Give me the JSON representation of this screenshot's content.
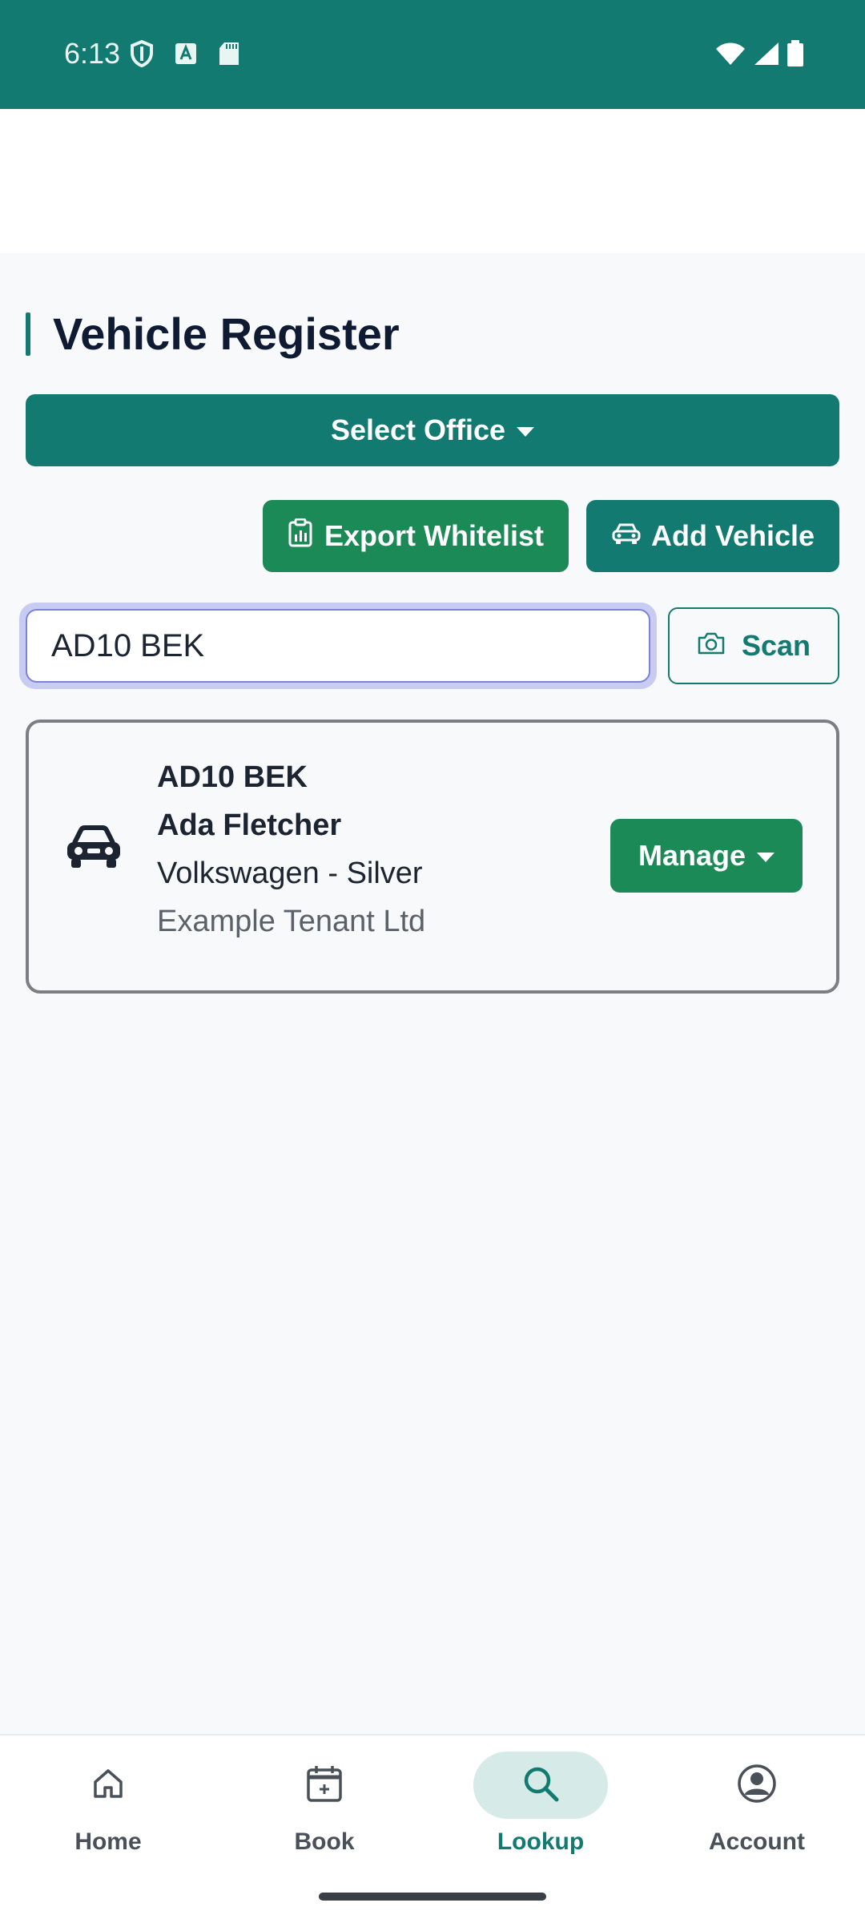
{
  "status_bar": {
    "time": "6:13",
    "left_icons": [
      "shield-icon",
      "font-icon",
      "sd-card-icon"
    ],
    "right_icons": [
      "wifi-icon",
      "signal-icon",
      "battery-icon"
    ]
  },
  "page": {
    "title": "Vehicle Register"
  },
  "actions": {
    "select_office_label": "Select Office",
    "export_label": "Export Whitelist",
    "add_label": "Add Vehicle"
  },
  "search": {
    "value": "AD10 BEK",
    "placeholder": "",
    "scan_label": "Scan"
  },
  "vehicle": {
    "plate": "AD10 BEK",
    "owner": "Ada Fletcher",
    "make_color": "Volkswagen - Silver",
    "tenant": "Example Tenant Ltd",
    "manage_label": "Manage"
  },
  "bottom_nav": {
    "items": [
      {
        "label": "Home",
        "icon": "home-icon",
        "active": false
      },
      {
        "label": "Book",
        "icon": "calendar-plus-icon",
        "active": false
      },
      {
        "label": "Lookup",
        "icon": "search-icon",
        "active": true
      },
      {
        "label": "Account",
        "icon": "account-icon",
        "active": false
      }
    ]
  },
  "colors": {
    "primary": "#127a70",
    "success": "#1c8a56",
    "active_nav_bg": "#d6ebe7",
    "focus_ring": "#c8cbf2"
  }
}
